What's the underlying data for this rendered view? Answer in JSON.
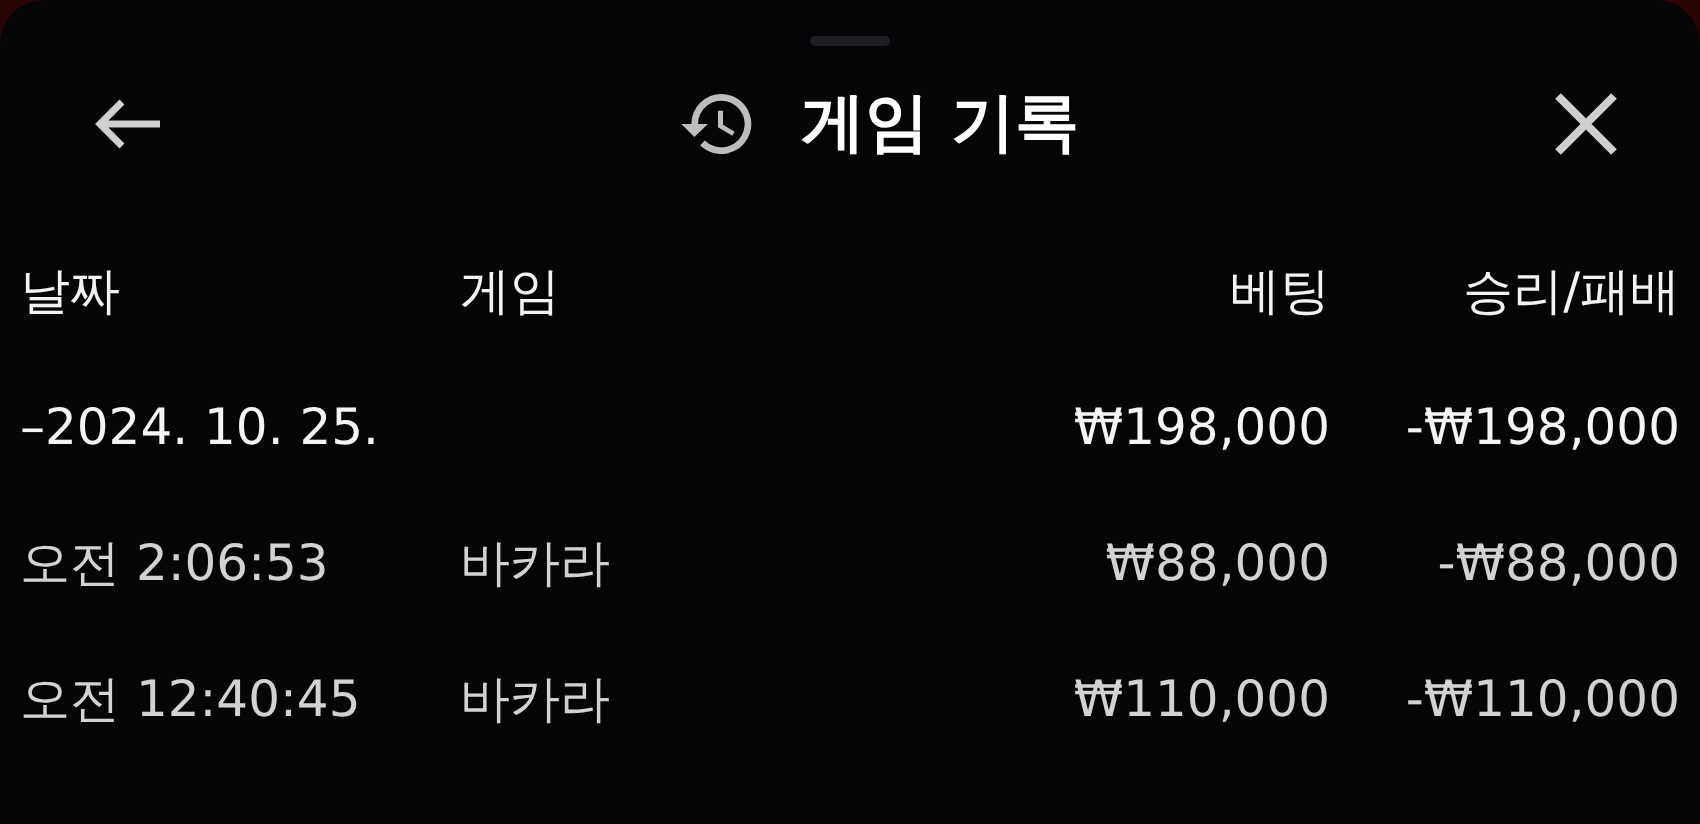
{
  "header": {
    "title": "게임 기록"
  },
  "table": {
    "columns": [
      "날짜",
      "게임",
      "베팅",
      "승리/패배"
    ],
    "rows": [
      {
        "kind": "group",
        "cells": [
          "–2024. 10. 25.",
          "",
          "₩198,000",
          "-₩198,000"
        ]
      },
      {
        "kind": "item",
        "cells": [
          "오전 2:06:53",
          "바카라",
          "₩88,000",
          "-₩88,000"
        ]
      },
      {
        "kind": "item",
        "cells": [
          "오전 12:40:45",
          "바카라",
          "₩110,000",
          "-₩110,000"
        ]
      }
    ]
  }
}
